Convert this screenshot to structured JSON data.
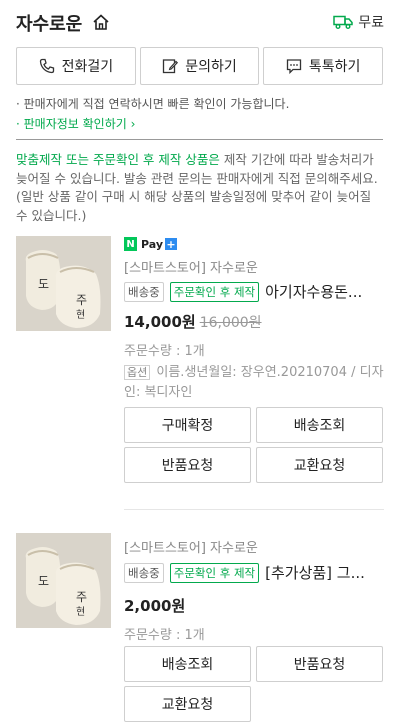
{
  "header": {
    "store_name": "자수로운",
    "shipping_label": "무료"
  },
  "contact_buttons": [
    {
      "label": "전화걸기",
      "icon": "phone-icon"
    },
    {
      "label": "문의하기",
      "icon": "edit-icon"
    },
    {
      "label": "톡톡하기",
      "icon": "chat-icon"
    }
  ],
  "notice": {
    "line1": "· 판매자에게 직접 연락하시면 빠른 확인이 가능합니다.",
    "link": "· 판매자정보 확인하기 ›"
  },
  "warning": {
    "highlight": "맞춤제작 또는 주문확인 후 제작 상품은",
    "rest": " 제작 기간에 따라 발송처리가 늦어질 수 있습니다. 발송 관련 문의는 판매자에게 직접 문의해주세요. (일반 상품 같이 구매 시 해당 상품의 발송일정에 맞추어 같이 늦어질 수 있습니다.)"
  },
  "items": [
    {
      "npay": "Pay",
      "seller": "[스마트스토어] 자수로운",
      "status": "배송중",
      "badge": "주문확인 후 제작",
      "name": "아기자수용돈...",
      "price": "14,000원",
      "orig_price": "16,000원",
      "qty": "주문수량 : 1개",
      "option_tag": "옵션",
      "option": "이름.생년월일: 장우연.20210704 / 디자인: 복디자인",
      "buttons": [
        "구매확정",
        "배송조회",
        "반품요청",
        "교환요청"
      ]
    },
    {
      "seller": "[스마트스토어] 자수로운",
      "status": "배송중",
      "badge": "주문확인 후 제작",
      "name": "[추가상품] 그...",
      "price": "2,000원",
      "qty": "주문수량 : 1개",
      "buttons": [
        "배송조회",
        "반품요청",
        "교환요청"
      ]
    }
  ],
  "colors": {
    "accent": "#03a94d",
    "npay": "#03c75a"
  }
}
